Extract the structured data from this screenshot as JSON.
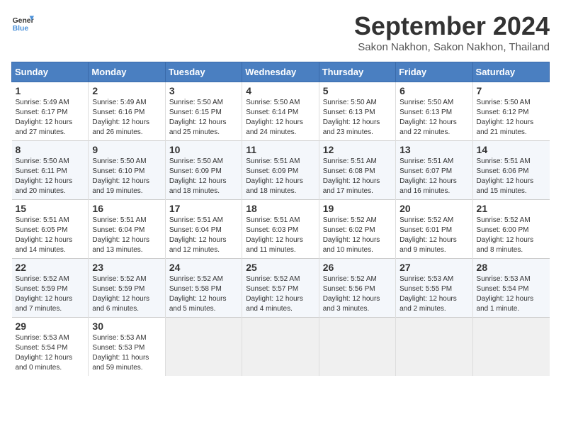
{
  "header": {
    "logo_line1": "General",
    "logo_line2": "Blue",
    "month": "September 2024",
    "location": "Sakon Nakhon, Sakon Nakhon, Thailand"
  },
  "weekdays": [
    "Sunday",
    "Monday",
    "Tuesday",
    "Wednesday",
    "Thursday",
    "Friday",
    "Saturday"
  ],
  "weeks": [
    [
      {
        "day": 1,
        "sunrise": "5:49 AM",
        "sunset": "6:17 PM",
        "daylight": "12 hours and 27 minutes."
      },
      {
        "day": 2,
        "sunrise": "5:49 AM",
        "sunset": "6:16 PM",
        "daylight": "12 hours and 26 minutes."
      },
      {
        "day": 3,
        "sunrise": "5:50 AM",
        "sunset": "6:15 PM",
        "daylight": "12 hours and 25 minutes."
      },
      {
        "day": 4,
        "sunrise": "5:50 AM",
        "sunset": "6:14 PM",
        "daylight": "12 hours and 24 minutes."
      },
      {
        "day": 5,
        "sunrise": "5:50 AM",
        "sunset": "6:13 PM",
        "daylight": "12 hours and 23 minutes."
      },
      {
        "day": 6,
        "sunrise": "5:50 AM",
        "sunset": "6:13 PM",
        "daylight": "12 hours and 22 minutes."
      },
      {
        "day": 7,
        "sunrise": "5:50 AM",
        "sunset": "6:12 PM",
        "daylight": "12 hours and 21 minutes."
      }
    ],
    [
      {
        "day": 8,
        "sunrise": "5:50 AM",
        "sunset": "6:11 PM",
        "daylight": "12 hours and 20 minutes."
      },
      {
        "day": 9,
        "sunrise": "5:50 AM",
        "sunset": "6:10 PM",
        "daylight": "12 hours and 19 minutes."
      },
      {
        "day": 10,
        "sunrise": "5:50 AM",
        "sunset": "6:09 PM",
        "daylight": "12 hours and 18 minutes."
      },
      {
        "day": 11,
        "sunrise": "5:51 AM",
        "sunset": "6:09 PM",
        "daylight": "12 hours and 18 minutes."
      },
      {
        "day": 12,
        "sunrise": "5:51 AM",
        "sunset": "6:08 PM",
        "daylight": "12 hours and 17 minutes."
      },
      {
        "day": 13,
        "sunrise": "5:51 AM",
        "sunset": "6:07 PM",
        "daylight": "12 hours and 16 minutes."
      },
      {
        "day": 14,
        "sunrise": "5:51 AM",
        "sunset": "6:06 PM",
        "daylight": "12 hours and 15 minutes."
      }
    ],
    [
      {
        "day": 15,
        "sunrise": "5:51 AM",
        "sunset": "6:05 PM",
        "daylight": "12 hours and 14 minutes."
      },
      {
        "day": 16,
        "sunrise": "5:51 AM",
        "sunset": "6:04 PM",
        "daylight": "12 hours and 13 minutes."
      },
      {
        "day": 17,
        "sunrise": "5:51 AM",
        "sunset": "6:04 PM",
        "daylight": "12 hours and 12 minutes."
      },
      {
        "day": 18,
        "sunrise": "5:51 AM",
        "sunset": "6:03 PM",
        "daylight": "12 hours and 11 minutes."
      },
      {
        "day": 19,
        "sunrise": "5:52 AM",
        "sunset": "6:02 PM",
        "daylight": "12 hours and 10 minutes."
      },
      {
        "day": 20,
        "sunrise": "5:52 AM",
        "sunset": "6:01 PM",
        "daylight": "12 hours and 9 minutes."
      },
      {
        "day": 21,
        "sunrise": "5:52 AM",
        "sunset": "6:00 PM",
        "daylight": "12 hours and 8 minutes."
      }
    ],
    [
      {
        "day": 22,
        "sunrise": "5:52 AM",
        "sunset": "5:59 PM",
        "daylight": "12 hours and 7 minutes."
      },
      {
        "day": 23,
        "sunrise": "5:52 AM",
        "sunset": "5:59 PM",
        "daylight": "12 hours and 6 minutes."
      },
      {
        "day": 24,
        "sunrise": "5:52 AM",
        "sunset": "5:58 PM",
        "daylight": "12 hours and 5 minutes."
      },
      {
        "day": 25,
        "sunrise": "5:52 AM",
        "sunset": "5:57 PM",
        "daylight": "12 hours and 4 minutes."
      },
      {
        "day": 26,
        "sunrise": "5:52 AM",
        "sunset": "5:56 PM",
        "daylight": "12 hours and 3 minutes."
      },
      {
        "day": 27,
        "sunrise": "5:53 AM",
        "sunset": "5:55 PM",
        "daylight": "12 hours and 2 minutes."
      },
      {
        "day": 28,
        "sunrise": "5:53 AM",
        "sunset": "5:54 PM",
        "daylight": "12 hours and 1 minute."
      }
    ],
    [
      {
        "day": 29,
        "sunrise": "5:53 AM",
        "sunset": "5:54 PM",
        "daylight": "12 hours and 0 minutes."
      },
      {
        "day": 30,
        "sunrise": "5:53 AM",
        "sunset": "5:53 PM",
        "daylight": "11 hours and 59 minutes."
      },
      null,
      null,
      null,
      null,
      null
    ]
  ]
}
